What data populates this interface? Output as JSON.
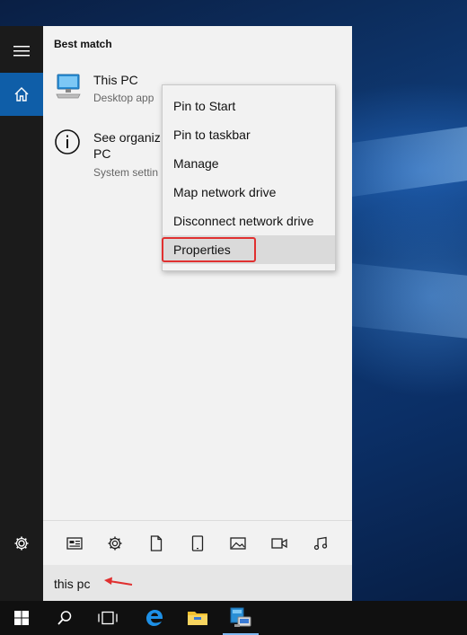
{
  "start_menu": {
    "section_title": "Best match",
    "results": [
      {
        "title": "This PC",
        "subtitle": "Desktop app",
        "icon": "computer-icon"
      },
      {
        "title_line1": "See organiz",
        "title_line2": "PC",
        "subtitle": "System settin",
        "icon": "info-icon"
      }
    ]
  },
  "context_menu": {
    "items": [
      {
        "label": "Pin to Start"
      },
      {
        "label": "Pin to taskbar"
      },
      {
        "label": "Manage"
      },
      {
        "label": "Map network drive"
      },
      {
        "label": "Disconnect network drive"
      },
      {
        "label": "Properties",
        "highlighted": true
      }
    ]
  },
  "filters": [
    "apps-icon",
    "settings-icon",
    "documents-icon",
    "tablet-icon",
    "photos-icon",
    "videos-icon",
    "music-icon"
  ],
  "search": {
    "value": "this pc"
  },
  "sidebar": [
    "hamburger-icon",
    "home-icon",
    "settings-icon"
  ],
  "taskbar": [
    "windows-start-icon",
    "search-icon",
    "task-view-icon",
    "edge-icon",
    "file-explorer-icon",
    "network-computer-icon"
  ],
  "colors": {
    "accent": "#0f5ea8",
    "annotation": "#e03030"
  }
}
